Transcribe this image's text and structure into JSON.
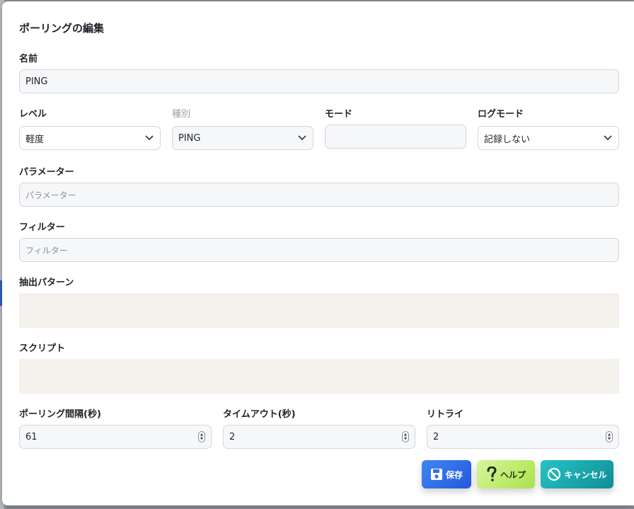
{
  "dialog": {
    "title": "ポーリングの編集"
  },
  "form": {
    "name": {
      "label": "名前",
      "value": "PING"
    },
    "level": {
      "label": "レベル",
      "value": "軽度"
    },
    "type": {
      "label": "種別",
      "value": "PING"
    },
    "mode": {
      "label": "モード",
      "value": ""
    },
    "log_mode": {
      "label": "ログモード",
      "value": "記録しない"
    },
    "parameter": {
      "label": "パラメーター",
      "placeholder": "パラメーター"
    },
    "filter": {
      "label": "フィルター",
      "placeholder": "フィルター"
    },
    "extract_pattern": {
      "label": "抽出パターン",
      "value": ""
    },
    "script": {
      "label": "スクリプト",
      "value": ""
    },
    "interval": {
      "label": "ポーリング間隔(秒)",
      "value": "61"
    },
    "timeout": {
      "label": "タイムアウト(秒)",
      "value": "2"
    },
    "retry": {
      "label": "リトライ",
      "value": "2"
    }
  },
  "buttons": {
    "save": "保存",
    "help": "ヘルプ",
    "cancel": "キャンセル"
  },
  "colors": {
    "save_button": "#2f6fe6",
    "help_button": "#b9ec6a",
    "cancel_button": "#17a9b0",
    "code_area": "#f4f1ed"
  },
  "icons": {
    "save": "floppy-disk-icon",
    "help": "question-mark-icon",
    "cancel": "prohibited-icon",
    "dropdown": "chevron-down-icon",
    "stepper": "up-down-stepper-icon"
  }
}
